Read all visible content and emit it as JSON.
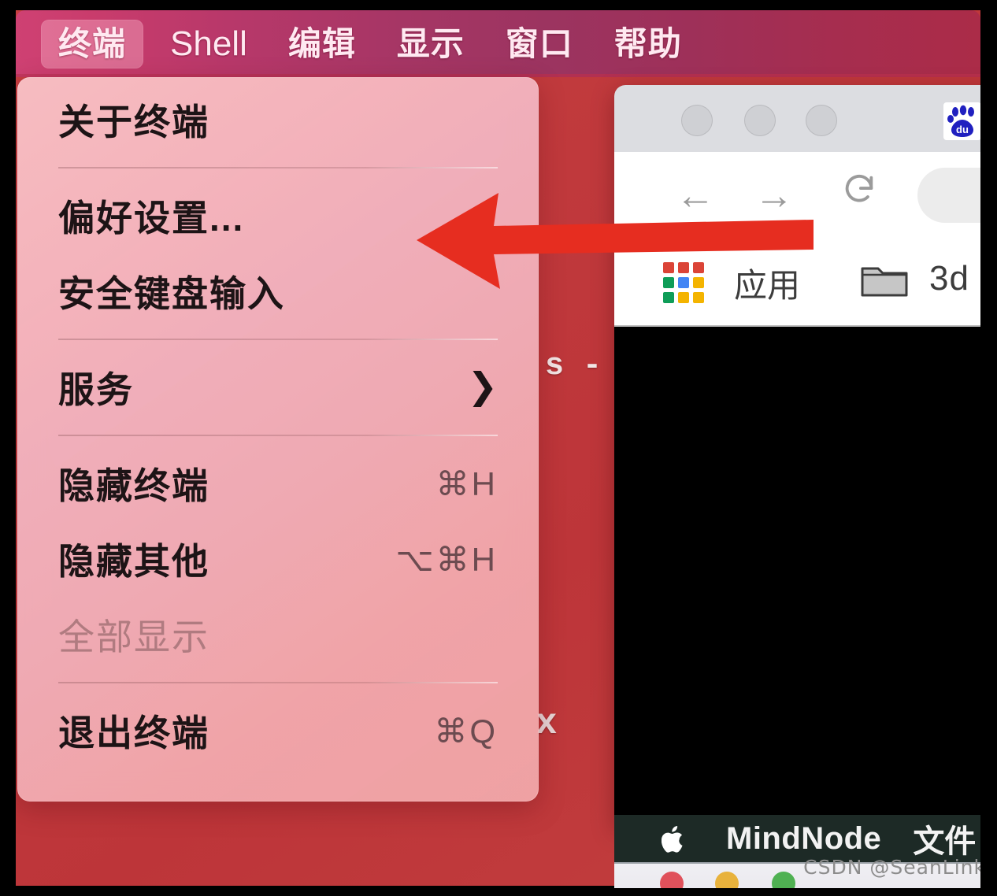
{
  "menubar": {
    "items": [
      {
        "label": "终端",
        "active": true,
        "latin": false
      },
      {
        "label": "Shell",
        "active": false,
        "latin": true
      },
      {
        "label": "编辑",
        "active": false,
        "latin": false
      },
      {
        "label": "显示",
        "active": false,
        "latin": false
      },
      {
        "label": "窗口",
        "active": false,
        "latin": false
      },
      {
        "label": "帮助",
        "active": false,
        "latin": false
      }
    ]
  },
  "dropdown": {
    "items": [
      {
        "label": "关于终端",
        "shortcut": "",
        "submenu": false,
        "disabled": false
      },
      {
        "label": "偏好设置...",
        "shortcut": "",
        "submenu": false,
        "disabled": false
      },
      {
        "label": "安全键盘输入",
        "shortcut": "",
        "submenu": false,
        "disabled": false
      },
      {
        "label": "服务",
        "shortcut": "",
        "submenu": true,
        "disabled": false
      },
      {
        "label": "隐藏终端",
        "shortcut": "⌘H",
        "submenu": false,
        "disabled": false
      },
      {
        "label": "隐藏其他",
        "shortcut": "⌥⌘H",
        "submenu": false,
        "disabled": false
      },
      {
        "label": "全部显示",
        "shortcut": "",
        "submenu": false,
        "disabled": true
      },
      {
        "label": "退出终端",
        "shortcut": "⌘Q",
        "submenu": false,
        "disabled": false
      }
    ],
    "submenu_chevron": "❯"
  },
  "desktop_fragments": {
    "terminal_text": "s -",
    "mark_x": "x"
  },
  "browser": {
    "favicon_name": "baidu-logo",
    "nav": {
      "back": "←",
      "forward": "→",
      "reload": "⟳"
    },
    "bookmarks": [
      {
        "label": "应用",
        "icon": "apps-grid-icon"
      },
      {
        "label": "3d",
        "icon": "folder-icon"
      }
    ]
  },
  "mindnode_bar": {
    "apple": "apple-logo",
    "app_name": "MindNode",
    "menu_item": "文件"
  },
  "watermark": {
    "text": "CSDN @SeanLink"
  },
  "colors": {
    "menubar_accent": "#b0305a",
    "arrow_red": "#e62d20",
    "menu_panel": "#f6bcc2",
    "desktop_red": "#c23a3d",
    "traffic_red": "#e0515b",
    "traffic_yellow": "#e8b23c",
    "traffic_green": "#4fb152"
  }
}
